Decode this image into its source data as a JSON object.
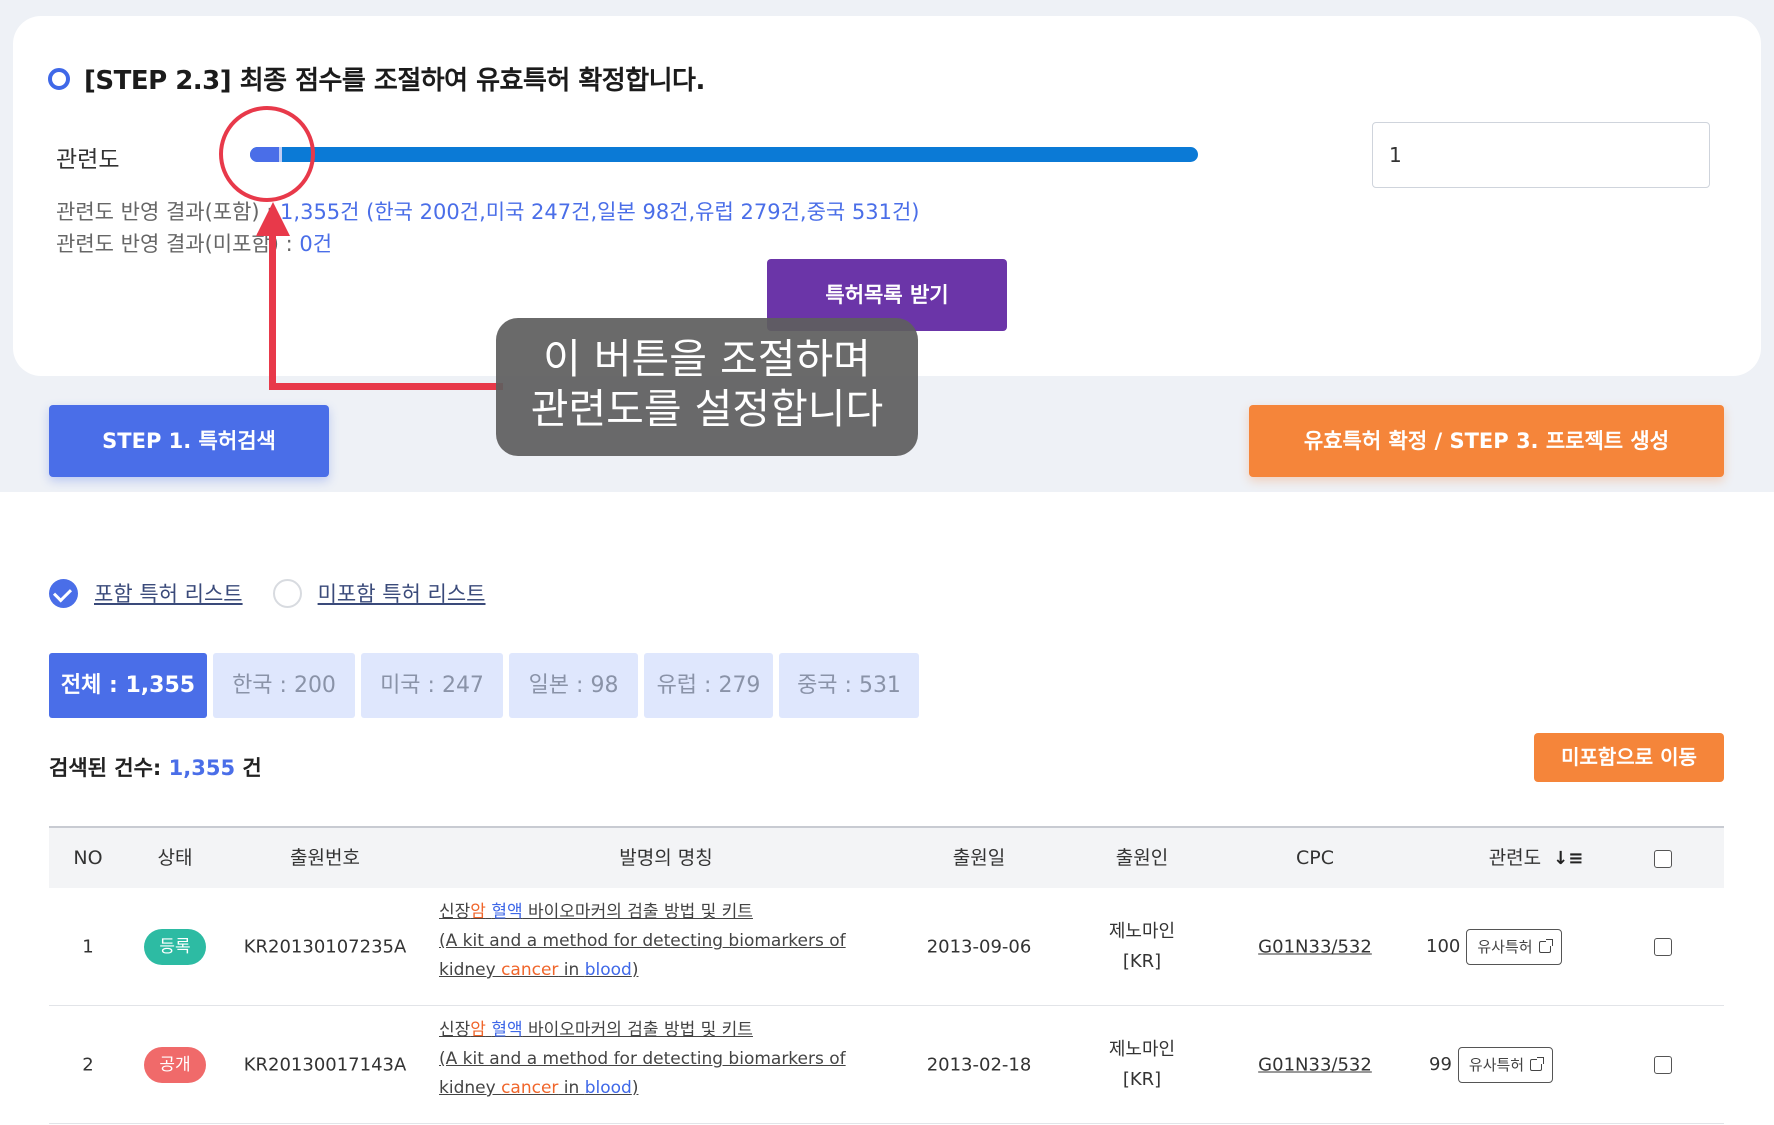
{
  "step": {
    "title": "[STEP 2.3] 최종 점수를 조절하여 유효특허 확정합니다.",
    "relevance_label": "관련도",
    "slider_value": 0.03,
    "input_value": "1",
    "result_included_prefix": "관련도 반영 결과(포함) : ",
    "result_included_value": "1,355건 (한국 200건,미국 247건,일본 98건,유럽 279건,중국 531건)",
    "result_excluded_prefix": "관련도 반영 결과(미포함) : ",
    "result_excluded_value": "0건",
    "get_list_button": "특허목록 받기"
  },
  "tooltip": {
    "line1": "이 버튼을 조절하며",
    "line2": "관련도를 설정합니다"
  },
  "nav": {
    "step1_button": "STEP 1. 특허검색",
    "step3_button": "유효특허 확정 / STEP 3. 프로젝트 생성"
  },
  "list_toggle": {
    "included": "포함 특허 리스트",
    "excluded": "미포함 특허 리스트"
  },
  "country_tabs": [
    "전체 : 1,355",
    "한국 : 200",
    "미국 : 247",
    "일본 : 98",
    "유럽 : 279",
    "중국 : 531"
  ],
  "count": {
    "label": "검색된 건수: ",
    "value": "1,355",
    "unit": " 건"
  },
  "move_button": "미포함으로 이동",
  "table": {
    "headers": [
      "NO",
      "상태",
      "출원번호",
      "발명의 명칭",
      "출원일",
      "출원인",
      "CPC",
      "관련도"
    ],
    "rows": [
      {
        "no": "1",
        "status": "등록",
        "app_no": "KR20130107235A",
        "title_ko_a": "신장",
        "title_ko_b": "암",
        "title_ko_c": "혈액",
        "title_ko_d": " 바이오마커의 검출 방법 및 키트",
        "title_en_1": "(A kit and a method for detecting biomarkers of",
        "title_en_2": "kidney ",
        "title_en_3": "cancer",
        "title_en_4": " in ",
        "title_en_5": "blood",
        "title_en_6": ")",
        "date": "2013-09-06",
        "applicant_1": "제노마인",
        "applicant_2": "[KR]",
        "cpc": "G01N33/532",
        "relevance": "100",
        "similar": "유사특허"
      },
      {
        "no": "2",
        "status": "공개",
        "app_no": "KR20130017143A",
        "title_ko_a": "신장",
        "title_ko_b": "암",
        "title_ko_c": "혈액",
        "title_ko_d": " 바이오마커의 검출 방법 및 키트",
        "title_en_1": "(A kit and a method for detecting biomarkers of",
        "title_en_2": "kidney ",
        "title_en_3": "cancer",
        "title_en_4": " in ",
        "title_en_5": "blood",
        "title_en_6": ")",
        "date": "2013-02-18",
        "applicant_1": "제노마인",
        "applicant_2": "[KR]",
        "cpc": "G01N33/532",
        "relevance": "99",
        "similar": "유사특허"
      }
    ]
  },
  "colors": {
    "primary": "#4a6ee8",
    "accent_orange": "#f5853a",
    "purple": "#6b35a8",
    "annotation_red": "#e8394a",
    "badge_registered": "#2dbba3",
    "badge_published": "#f06a6a"
  }
}
